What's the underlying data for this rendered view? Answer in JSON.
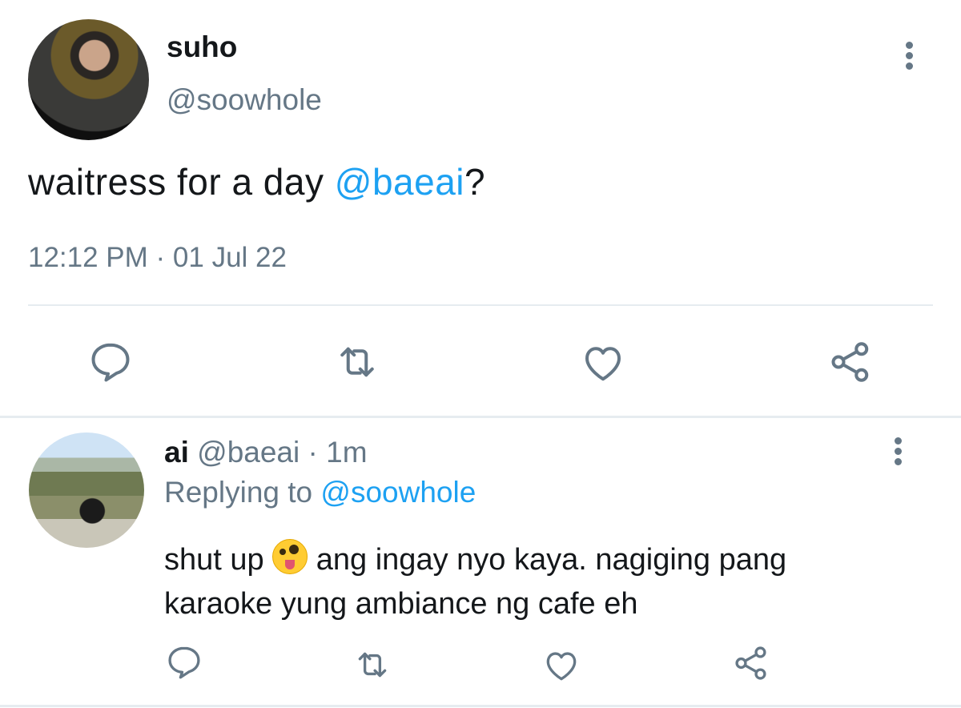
{
  "main_tweet": {
    "name": "suho",
    "handle": "@soowhole",
    "text_before": "waitress for a day ",
    "mention": "@baeai",
    "text_after": "?",
    "timestamp": "12:12 PM · 01 Jul 22"
  },
  "reply": {
    "name": "ai",
    "handle": "@baeai",
    "separator": " · ",
    "time": "1m",
    "replying_prefix": "Replying to ",
    "replying_handle": "@soowhole",
    "text_before_emoji": "shut up ",
    "emoji": "zany-face",
    "text_after_emoji": " ang ingay nyo kaya. nagiging pang karaoke yung ambiance ng cafe eh"
  },
  "colors": {
    "link": "#1da1f2",
    "secondary_text": "#657786",
    "primary_text": "#14171a",
    "divider": "#e6ecf0"
  },
  "icons": [
    "reply-icon",
    "retweet-icon",
    "like-icon",
    "share-icon",
    "more-icon"
  ]
}
